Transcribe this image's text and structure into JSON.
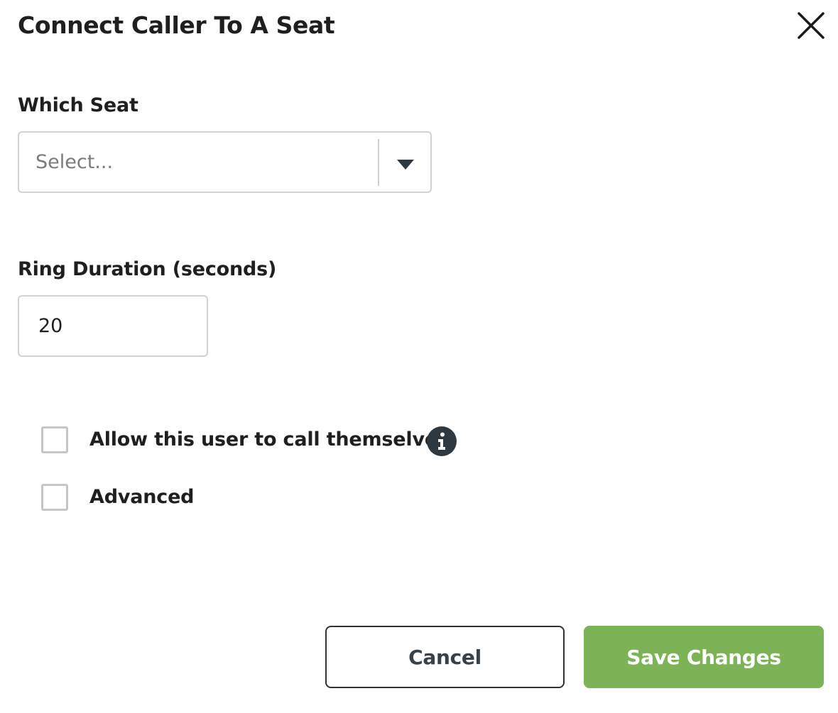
{
  "dialog": {
    "title": "Connect Caller To A Seat",
    "close_icon": "close-icon"
  },
  "seat_field": {
    "label": "Which Seat",
    "placeholder": "Select...",
    "dropdown_icon": "caret-down-icon"
  },
  "ring_duration": {
    "label": "Ring Duration (seconds)",
    "value": "20"
  },
  "options": {
    "allow_self_call": {
      "label": "Allow this user to call themselves",
      "checked": false,
      "info_icon": "info-icon"
    },
    "advanced": {
      "label": "Advanced",
      "checked": false
    }
  },
  "footer": {
    "cancel_label": "Cancel",
    "save_label": "Save Changes"
  },
  "colors": {
    "save_button": "#7db357",
    "info_icon_bg": "#2d3841",
    "border": "#d2d2d2"
  }
}
